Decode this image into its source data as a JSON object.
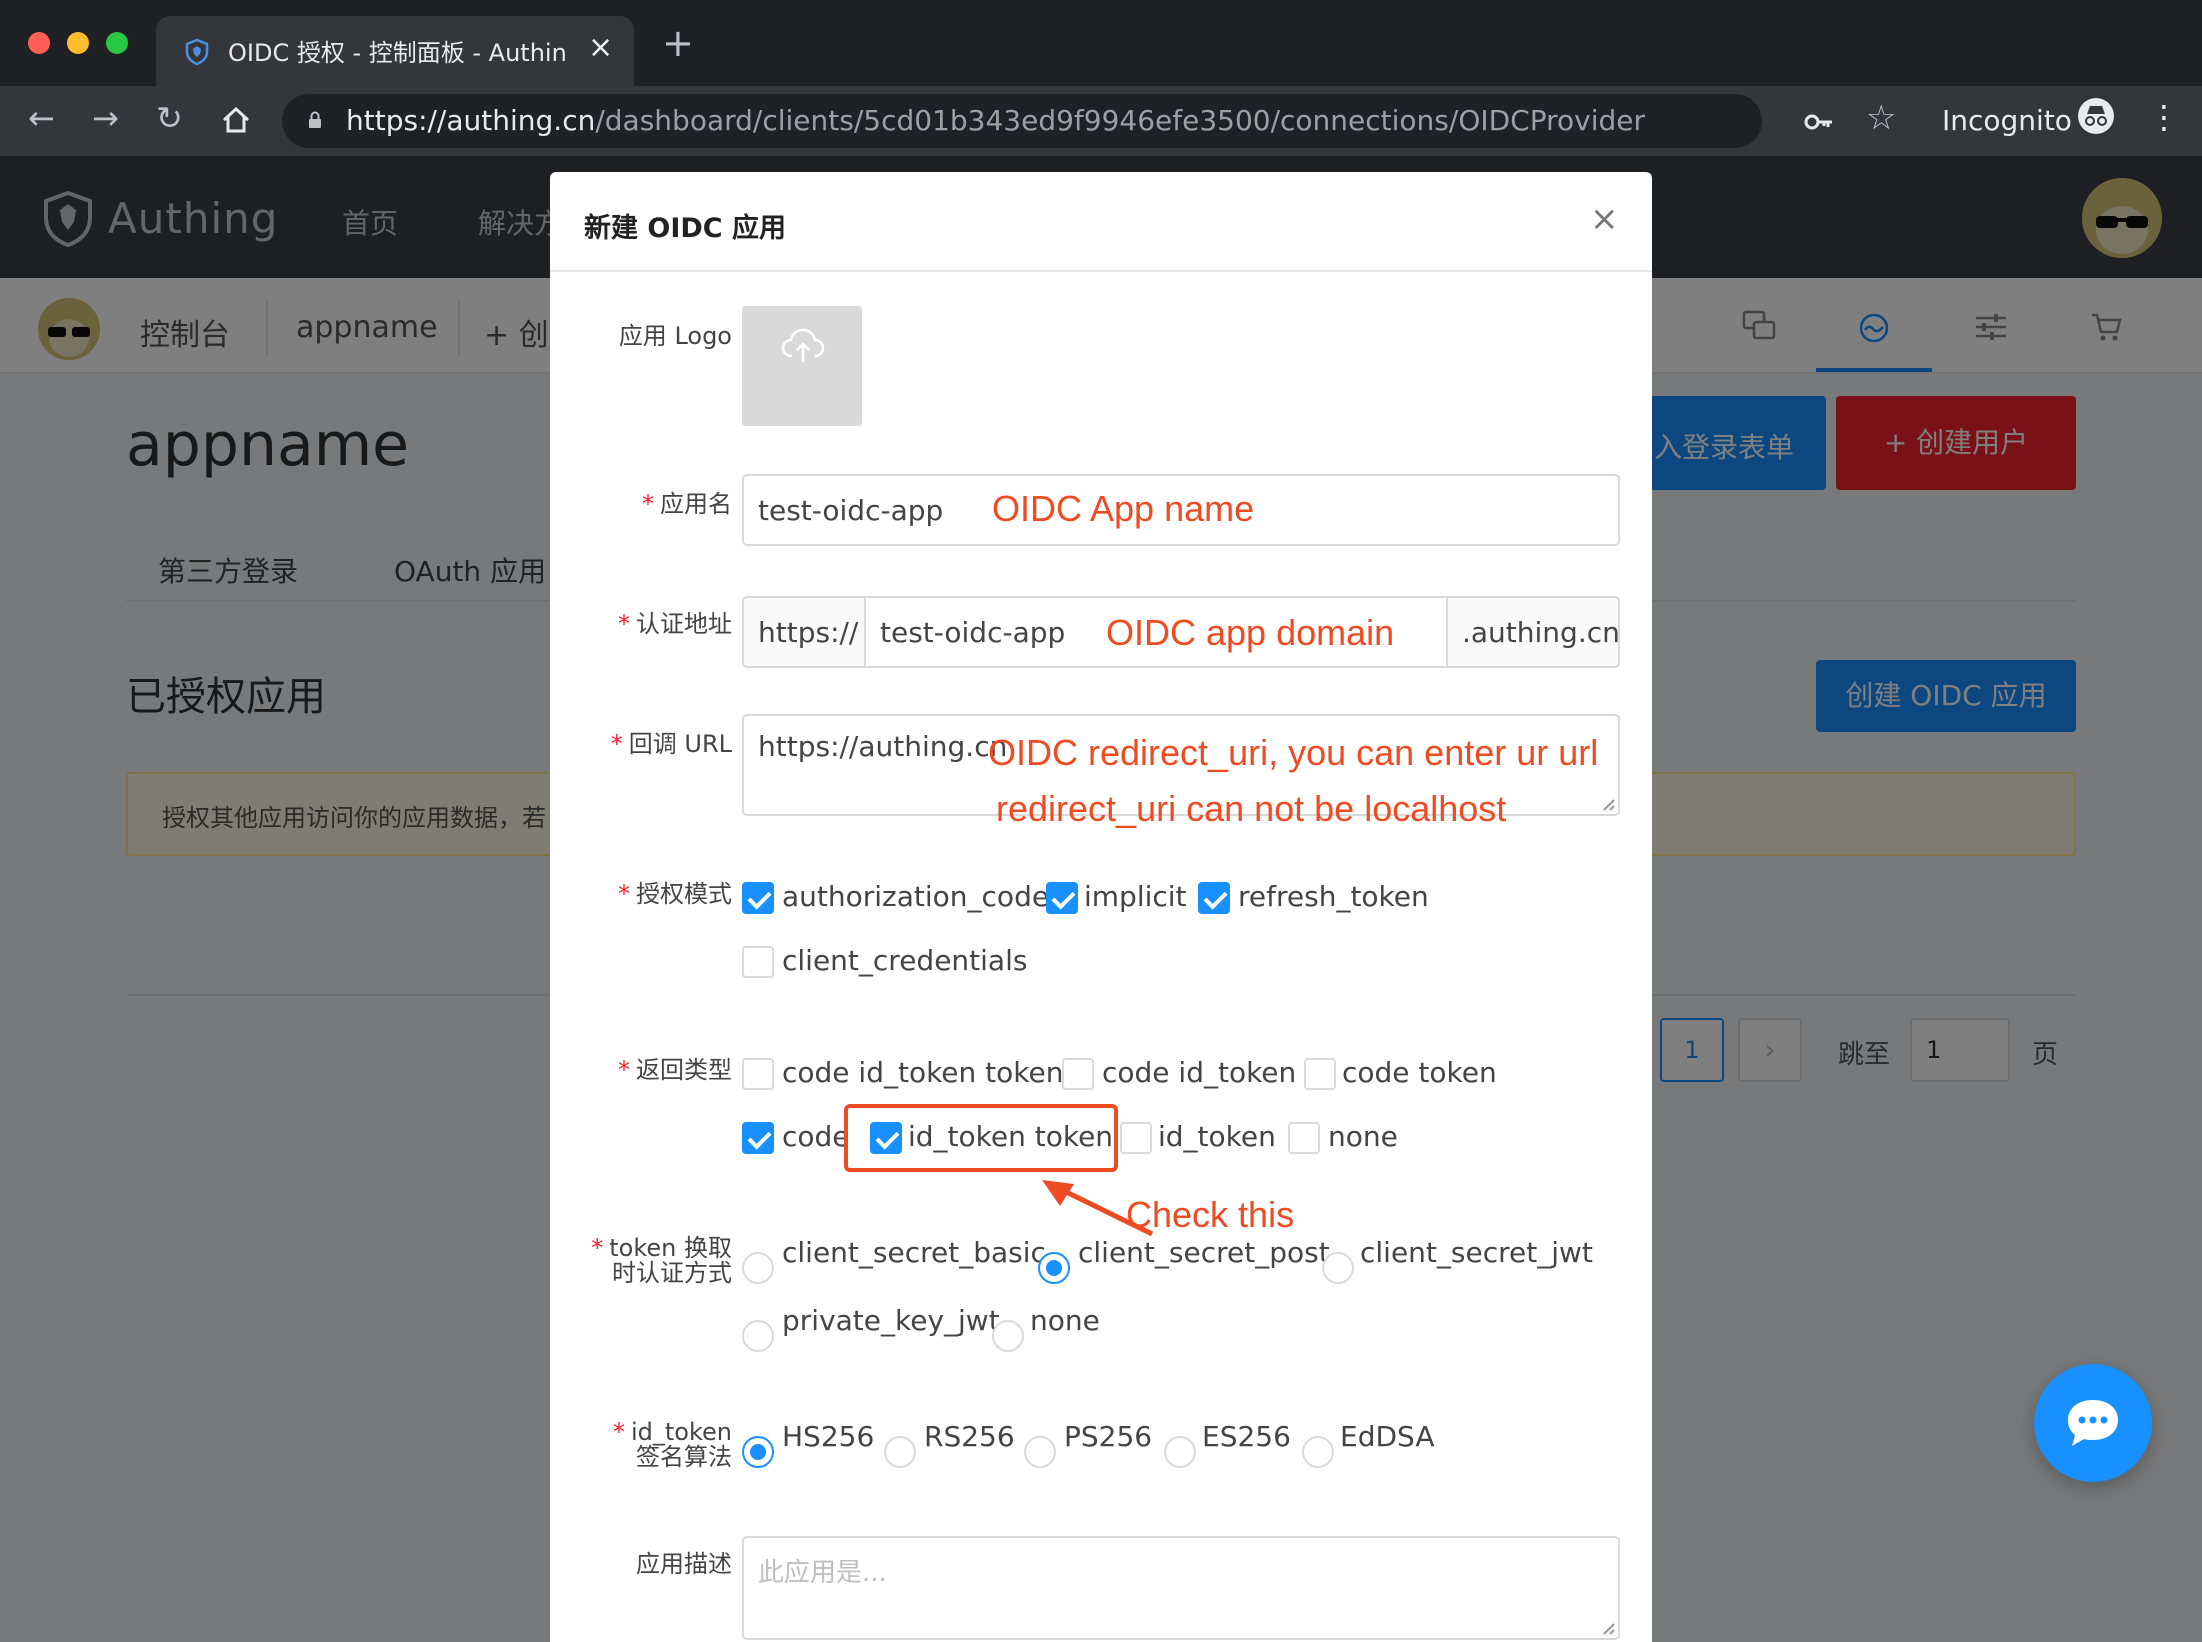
{
  "browser": {
    "tab_title": "OIDC 授权 - 控制面板 - Authing",
    "url_host": "https://authing.cn",
    "url_path": "/dashboard/clients/5cd01b343ed9f9946efe3500/connections/OIDCProvider",
    "incognito_label": "Incognito",
    "new_tab_label": "+",
    "colors": {
      "traffic_red": "#ff5f57",
      "traffic_yellow": "#febc2e",
      "traffic_green": "#28c840"
    }
  },
  "header": {
    "brand": "Authing",
    "nav": [
      "首页",
      "解决方"
    ]
  },
  "subnav": {
    "console": "控制台",
    "appname": "appname",
    "create": "+ 创",
    "icons": [
      "connections-icon",
      "monitor-icon",
      "settings-sliders-icon",
      "cart-icon"
    ]
  },
  "page": {
    "title": "appname",
    "tabs": [
      "第三方登录",
      "OAuth 应用"
    ],
    "section_title": "已授权应用",
    "btn_login_form": "入登录表单",
    "btn_create_user": "+ 创建用户",
    "btn_create_oidc": "创建 OIDC 应用",
    "alert": "授权其他应用访问你的应用数据，若",
    "pagination": {
      "current": "1",
      "next": "›",
      "jump_label": "跳至",
      "jump_value": "1",
      "jump_suffix": "页"
    }
  },
  "modal": {
    "title": "新建 OIDC 应用",
    "close": "×",
    "logo_label": "应用 Logo",
    "name_label": "应用名",
    "name_value": "test-oidc-app",
    "domain_label": "认证地址",
    "domain_prefix": "https://",
    "domain_value": "test-oidc-app",
    "domain_suffix": ".authing.cn",
    "redirect_label": "回调 URL",
    "redirect_value": "https://authing.cn",
    "grant_label": "授权模式",
    "grant_types": [
      {
        "label": "authorization_code",
        "checked": true
      },
      {
        "label": "implicit",
        "checked": true
      },
      {
        "label": "refresh_token",
        "checked": true
      },
      {
        "label": "client_credentials",
        "checked": false
      }
    ],
    "response_label": "返回类型",
    "response_types": [
      {
        "label": "code id_token token",
        "checked": false
      },
      {
        "label": "code id_token",
        "checked": false
      },
      {
        "label": "code token",
        "checked": false
      },
      {
        "label": "code",
        "checked": true
      },
      {
        "label": "id_token token",
        "checked": true
      },
      {
        "label": "id_token",
        "checked": false
      },
      {
        "label": "none",
        "checked": false
      }
    ],
    "token_auth_label_1": "token 换取",
    "token_auth_label_2": "时认证方式",
    "token_auth_methods": [
      {
        "label": "client_secret_basic",
        "selected": false
      },
      {
        "label": "client_secret_post",
        "selected": true
      },
      {
        "label": "client_secret_jwt",
        "selected": false
      },
      {
        "label": "private_key_jwt",
        "selected": false
      },
      {
        "label": "none",
        "selected": false
      }
    ],
    "sign_label_1": "id_token",
    "sign_label_2": "签名算法",
    "sign_algorithms": [
      {
        "label": "HS256",
        "selected": true
      },
      {
        "label": "RS256",
        "selected": false
      },
      {
        "label": "PS256",
        "selected": false
      },
      {
        "label": "ES256",
        "selected": false
      },
      {
        "label": "EdDSA",
        "selected": false
      }
    ],
    "desc_label": "应用描述",
    "desc_placeholder": "此应用是..."
  },
  "annotations": {
    "app_name": "OIDC App name",
    "app_domain": "OIDC app domain",
    "redirect_1": "OIDC redirect_uri, you can enter ur url",
    "redirect_2": "redirect_uri can not be localhost",
    "check_this": "Check this",
    "color": "#ef4b23"
  }
}
